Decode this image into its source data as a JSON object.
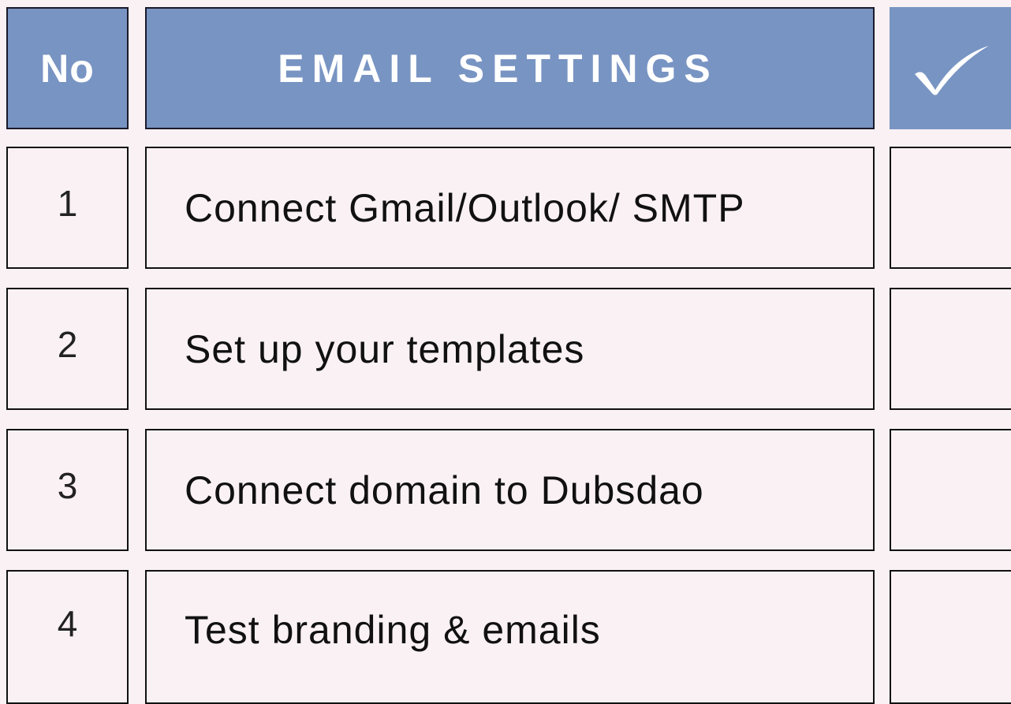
{
  "header": {
    "no_label": "No",
    "title": "EMAIL SETTINGS",
    "check_icon": "checkmark-icon"
  },
  "rows": [
    {
      "number": "1",
      "task": "Connect Gmail/Outlook/ SMTP",
      "checked": false
    },
    {
      "number": "2",
      "task": "Set up your templates",
      "checked": false
    },
    {
      "number": "3",
      "task": "Connect domain to Dubsdao",
      "checked": false
    },
    {
      "number": "4",
      "task": "Test branding & emails",
      "checked": false
    }
  ],
  "colors": {
    "header_bg": "#7894c3",
    "page_bg": "#faf1f4",
    "border": "#111111",
    "header_text": "#ffffff"
  }
}
